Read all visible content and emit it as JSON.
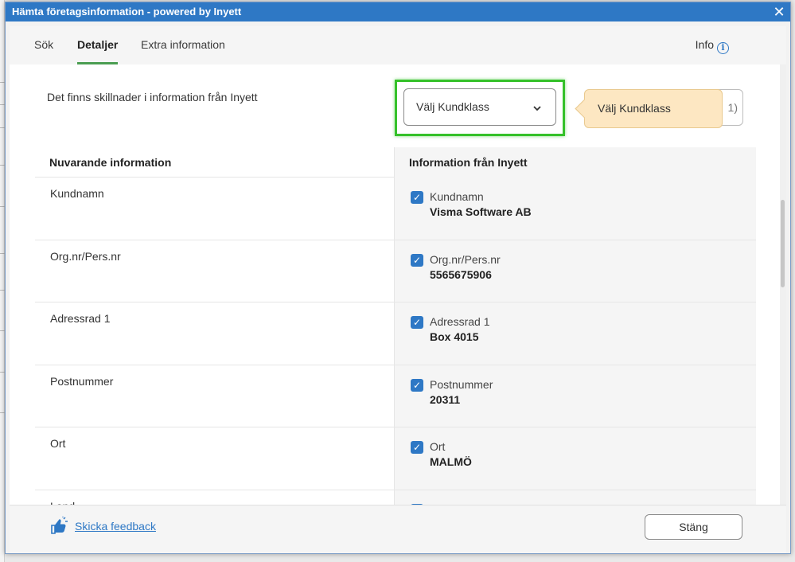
{
  "dialog": {
    "title": "Hämta företagsinformation - powered by Inyett",
    "close_glyph": "✕"
  },
  "tabs": [
    {
      "label": "Sök"
    },
    {
      "label": "Detaljer"
    },
    {
      "label": "Extra information"
    }
  ],
  "active_tab": "Detaljer",
  "info": {
    "label": "Info",
    "icon": "i"
  },
  "details": {
    "diff_text": "Det finns skillnader i information från Inyett",
    "kundklass_select": {
      "label": "Välj Kundklass",
      "chevron": "⌄"
    },
    "partial_button_text": "1)",
    "tooltip": "Välj Kundklass"
  },
  "table": {
    "header_current": "Nuvarande information",
    "header_inyett": "Information från Inyett",
    "rows": [
      {
        "current": "Kundnamn",
        "label": "Kundnamn",
        "value": "Visma Software AB",
        "checked": true
      },
      {
        "current": "Org.nr/Pers.nr",
        "label": "Org.nr/Pers.nr",
        "value": "5565675906",
        "checked": true
      },
      {
        "current": "Adressrad 1",
        "label": "Adressrad 1",
        "value": "Box 4015",
        "checked": true
      },
      {
        "current": "Postnummer",
        "label": "Postnummer",
        "value": "20311",
        "checked": true
      },
      {
        "current": "Ort",
        "label": "Ort",
        "value": "MALMÖ",
        "checked": true
      },
      {
        "current": "Land",
        "label": "",
        "value": "",
        "checked": true
      }
    ]
  },
  "footer": {
    "feedback_link": "Skicka feedback",
    "close_button": "Stäng"
  },
  "colors": {
    "titlebar": "#2e78c5",
    "active_tab_underline": "#4b9e52",
    "highlight": "#35c12a",
    "tooltip_bg": "#fde7c2",
    "checkbox": "#2e78c5"
  }
}
